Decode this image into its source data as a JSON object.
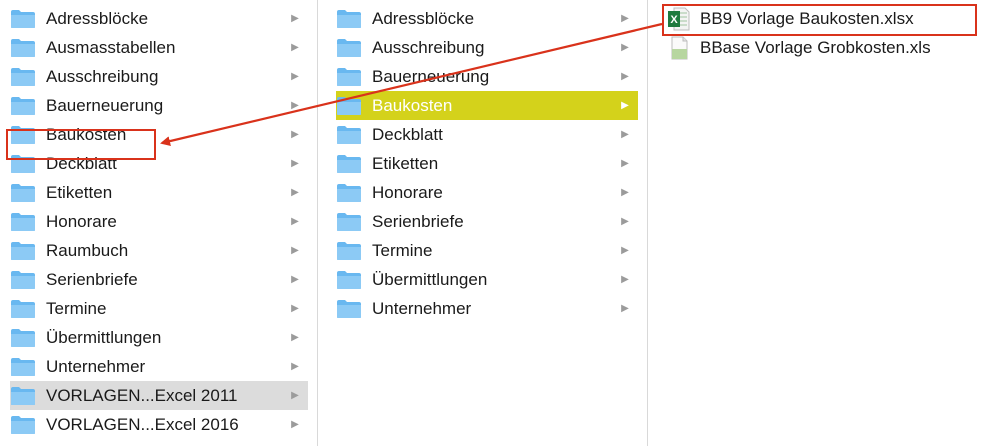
{
  "columns": [
    {
      "items": [
        {
          "label": "Adressblöcke",
          "icon": "folder-icon"
        },
        {
          "label": "Ausmasstabellen",
          "icon": "folder-icon"
        },
        {
          "label": "Ausschreibung",
          "icon": "folder-icon"
        },
        {
          "label": "Bauerneuerung",
          "icon": "folder-icon"
        },
        {
          "label": "Baukosten",
          "icon": "folder-icon"
        },
        {
          "label": "Deckblatt",
          "icon": "folder-icon"
        },
        {
          "label": "Etiketten",
          "icon": "folder-icon"
        },
        {
          "label": "Honorare",
          "icon": "folder-icon"
        },
        {
          "label": "Raumbuch",
          "icon": "folder-icon"
        },
        {
          "label": "Serienbriefe",
          "icon": "folder-icon"
        },
        {
          "label": "Termine",
          "icon": "folder-icon"
        },
        {
          "label": "Übermittlungen",
          "icon": "folder-icon"
        },
        {
          "label": "Unternehmer",
          "icon": "folder-icon"
        },
        {
          "label": "VORLAGEN...Excel 2011",
          "icon": "folder-icon"
        },
        {
          "label": "VORLAGEN...Excel 2016",
          "icon": "folder-icon"
        }
      ]
    },
    {
      "items": [
        {
          "label": "Adressblöcke",
          "icon": "folder-icon"
        },
        {
          "label": "Ausschreibung",
          "icon": "folder-icon"
        },
        {
          "label": "Bauerneuerung",
          "icon": "folder-icon"
        },
        {
          "label": "Baukosten",
          "icon": "folder-icon"
        },
        {
          "label": "Deckblatt",
          "icon": "folder-icon"
        },
        {
          "label": "Etiketten",
          "icon": "folder-icon"
        },
        {
          "label": "Honorare",
          "icon": "folder-icon"
        },
        {
          "label": "Serienbriefe",
          "icon": "folder-icon"
        },
        {
          "label": "Termine",
          "icon": "folder-icon"
        },
        {
          "label": "Übermittlungen",
          "icon": "folder-icon"
        },
        {
          "label": "Unternehmer",
          "icon": "folder-icon"
        }
      ]
    },
    {
      "items": [
        {
          "label": "BB9 Vorlage Baukosten.xlsx",
          "icon": "excel-file-icon"
        },
        {
          "label": "BBase Vorlage Grobkosten.xls",
          "icon": "generic-file-icon"
        }
      ]
    }
  ],
  "selection": {
    "column1_selected": "VORLAGEN...Excel 2011",
    "column2_selected": "Baukosten"
  },
  "annotation": {
    "box_color": "#d9321b",
    "arrow_color": "#d9321b",
    "arrow_from": "BB9 Vorlage Baukosten.xlsx",
    "arrow_to": "Baukosten"
  },
  "colors": {
    "folder_blue": "#69b8f0",
    "selection_yellow": "#d4d21b",
    "selection_gray": "#dcdcdc"
  }
}
